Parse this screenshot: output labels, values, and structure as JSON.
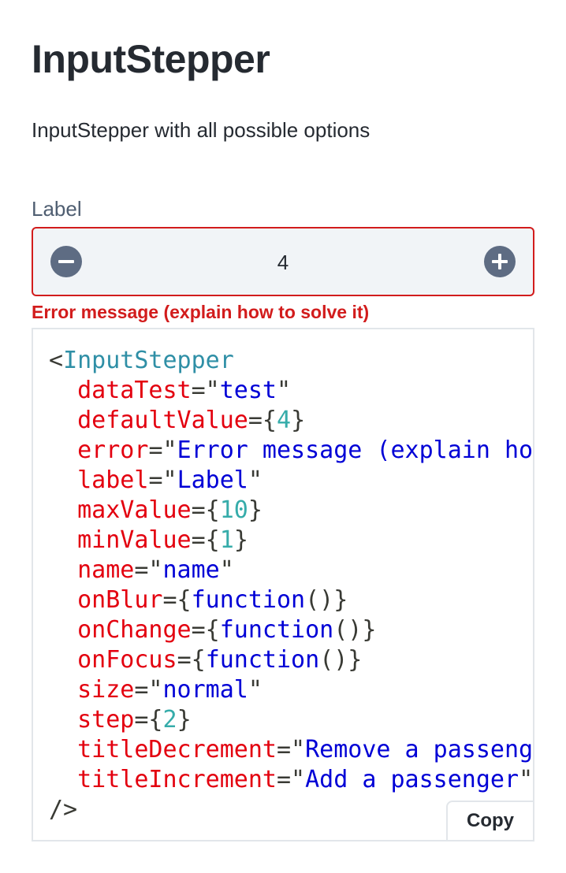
{
  "page": {
    "title": "InputStepper",
    "subtitle": "InputStepper with all possible options"
  },
  "stepper": {
    "label": "Label",
    "value": "4",
    "error": "Error message (explain how to solve it)",
    "decrement_icon": "minus-circle-icon",
    "increment_icon": "plus-circle-icon"
  },
  "code": {
    "lines": [
      [
        {
          "t": "<",
          "c": "punct"
        },
        {
          "t": "InputStepper",
          "c": "tag"
        }
      ],
      [
        {
          "t": "  "
        },
        {
          "t": "dataTest",
          "c": "attr"
        },
        {
          "t": "=\"",
          "c": "punct"
        },
        {
          "t": "test",
          "c": "str"
        },
        {
          "t": "\"",
          "c": "punct"
        }
      ],
      [
        {
          "t": "  "
        },
        {
          "t": "defaultValue",
          "c": "attr"
        },
        {
          "t": "={",
          "c": "punct"
        },
        {
          "t": "4",
          "c": "num"
        },
        {
          "t": "}",
          "c": "punct"
        }
      ],
      [
        {
          "t": "  "
        },
        {
          "t": "error",
          "c": "attr"
        },
        {
          "t": "=\"",
          "c": "punct"
        },
        {
          "t": "Error message (explain how to solve it)",
          "c": "str"
        },
        {
          "t": "\"",
          "c": "punct"
        }
      ],
      [
        {
          "t": "  "
        },
        {
          "t": "label",
          "c": "attr"
        },
        {
          "t": "=\"",
          "c": "punct"
        },
        {
          "t": "Label",
          "c": "str"
        },
        {
          "t": "\"",
          "c": "punct"
        }
      ],
      [
        {
          "t": "  "
        },
        {
          "t": "maxValue",
          "c": "attr"
        },
        {
          "t": "={",
          "c": "punct"
        },
        {
          "t": "10",
          "c": "num"
        },
        {
          "t": "}",
          "c": "punct"
        }
      ],
      [
        {
          "t": "  "
        },
        {
          "t": "minValue",
          "c": "attr"
        },
        {
          "t": "={",
          "c": "punct"
        },
        {
          "t": "1",
          "c": "num"
        },
        {
          "t": "}",
          "c": "punct"
        }
      ],
      [
        {
          "t": "  "
        },
        {
          "t": "name",
          "c": "attr"
        },
        {
          "t": "=\"",
          "c": "punct"
        },
        {
          "t": "name",
          "c": "str"
        },
        {
          "t": "\"",
          "c": "punct"
        }
      ],
      [
        {
          "t": "  "
        },
        {
          "t": "onBlur",
          "c": "attr"
        },
        {
          "t": "={",
          "c": "punct"
        },
        {
          "t": "function",
          "c": "str"
        },
        {
          "t": "()}",
          "c": "punct"
        }
      ],
      [
        {
          "t": "  "
        },
        {
          "t": "onChange",
          "c": "attr"
        },
        {
          "t": "={",
          "c": "punct"
        },
        {
          "t": "function",
          "c": "str"
        },
        {
          "t": "()}",
          "c": "punct"
        }
      ],
      [
        {
          "t": "  "
        },
        {
          "t": "onFocus",
          "c": "attr"
        },
        {
          "t": "={",
          "c": "punct"
        },
        {
          "t": "function",
          "c": "str"
        },
        {
          "t": "()}",
          "c": "punct"
        }
      ],
      [
        {
          "t": "  "
        },
        {
          "t": "size",
          "c": "attr"
        },
        {
          "t": "=\"",
          "c": "punct"
        },
        {
          "t": "normal",
          "c": "str"
        },
        {
          "t": "\"",
          "c": "punct"
        }
      ],
      [
        {
          "t": "  "
        },
        {
          "t": "step",
          "c": "attr"
        },
        {
          "t": "={",
          "c": "punct"
        },
        {
          "t": "2",
          "c": "num"
        },
        {
          "t": "}",
          "c": "punct"
        }
      ],
      [
        {
          "t": "  "
        },
        {
          "t": "titleDecrement",
          "c": "attr"
        },
        {
          "t": "=\"",
          "c": "punct"
        },
        {
          "t": "Remove a passenger",
          "c": "str"
        },
        {
          "t": "\"",
          "c": "punct"
        }
      ],
      [
        {
          "t": "  "
        },
        {
          "t": "titleIncrement",
          "c": "attr"
        },
        {
          "t": "=\"",
          "c": "punct"
        },
        {
          "t": "Add a passenger",
          "c": "str"
        },
        {
          "t": "\"",
          "c": "punct"
        }
      ],
      [
        {
          "t": "/>",
          "c": "punct"
        }
      ]
    ],
    "copy_label": "Copy"
  },
  "colors": {
    "error": "#d21c1c",
    "stepper_background": "#f1f4f7",
    "stepper_button": "#5e6c83",
    "label_text": "#4f5e71",
    "code_tag": "#2f8fa6",
    "code_attr": "#e3000f",
    "code_string": "#0000d6",
    "code_number": "#36acaa"
  }
}
